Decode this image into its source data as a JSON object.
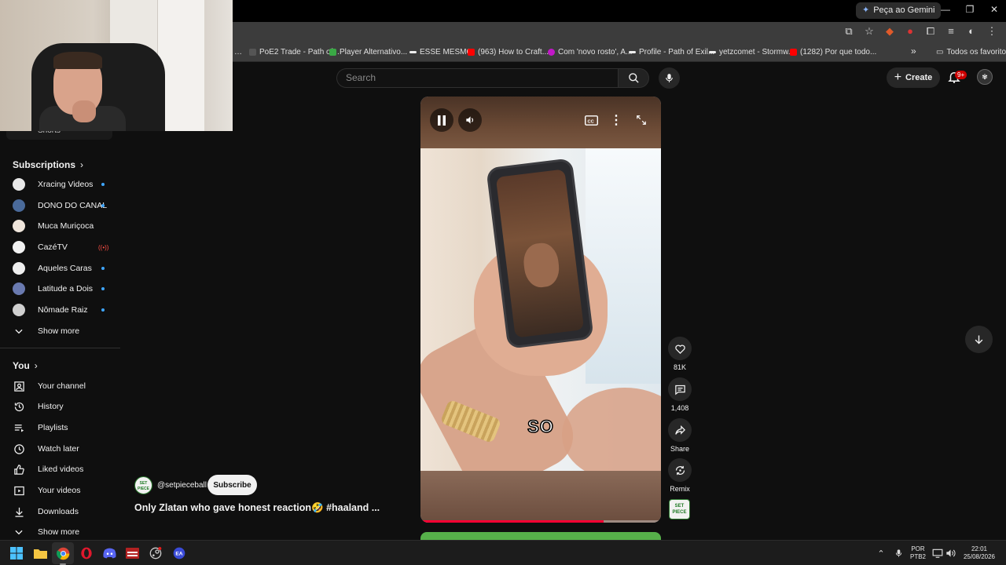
{
  "browser": {
    "gemini_label": "Peça ao Gemini",
    "bookmarks": [
      "PoE2 Trade - Path of...",
      "Player Alternativo...",
      "ESSE MESMO",
      "(963) How to Craft...",
      "Com 'novo rosto', A...",
      "Profile - Path of Exil...",
      "yetzcomet - Stormw...",
      "(1282) Por que todo..."
    ],
    "bookmarks_more": "»",
    "all_favorites": "Todos os favoritos"
  },
  "header": {
    "search_placeholder": "Search",
    "create_label": "Create",
    "notifications_badge": "9+"
  },
  "sidebar": {
    "shorts_label": "Shorts",
    "subscriptions_title": "Subscriptions",
    "subscriptions": [
      {
        "label": "Xracing Videos",
        "status": "new",
        "color": "#e8e8e8"
      },
      {
        "label": "DONO DO CANAL",
        "status": "new",
        "color": "#4a6a9a"
      },
      {
        "label": "Muca Muriçoca",
        "status": "",
        "color": "#f0e6dc"
      },
      {
        "label": "CazéTV",
        "status": "live",
        "color": "#f2f2f2"
      },
      {
        "label": "Aqueles Caras",
        "status": "new",
        "color": "#eeeeee"
      },
      {
        "label": "Latitude a Dois",
        "status": "new",
        "color": "#6a7ab0"
      },
      {
        "label": "Nômade Raiz",
        "status": "new",
        "color": "#cfcfcf"
      }
    ],
    "live_symbol": "((•))",
    "show_more_1": "Show more",
    "you_title": "You",
    "you_items": [
      "Your channel",
      "History",
      "Playlists",
      "Watch later",
      "Liked videos",
      "Your videos",
      "Downloads"
    ],
    "show_more_2": "Show more"
  },
  "short": {
    "caption": "SO",
    "progress": 0.76,
    "likes": "81K",
    "comments": "1,408",
    "share_label": "Share",
    "remix_label": "Remix",
    "channel_handle": "@setpieceball",
    "subscribe_label": "Subscribe",
    "title": "Only Zlatan who gave honest reaction🤣 #haaland ...",
    "channel_logo_text": "SET PIECE"
  },
  "taskbar": {
    "lang_top": "POR",
    "lang_bottom": "PTB2",
    "time": "22:01",
    "date": "25/08/2026"
  },
  "colors": {
    "youtube_red": "#ff0033",
    "accent_blue": "#3ea6ff"
  }
}
